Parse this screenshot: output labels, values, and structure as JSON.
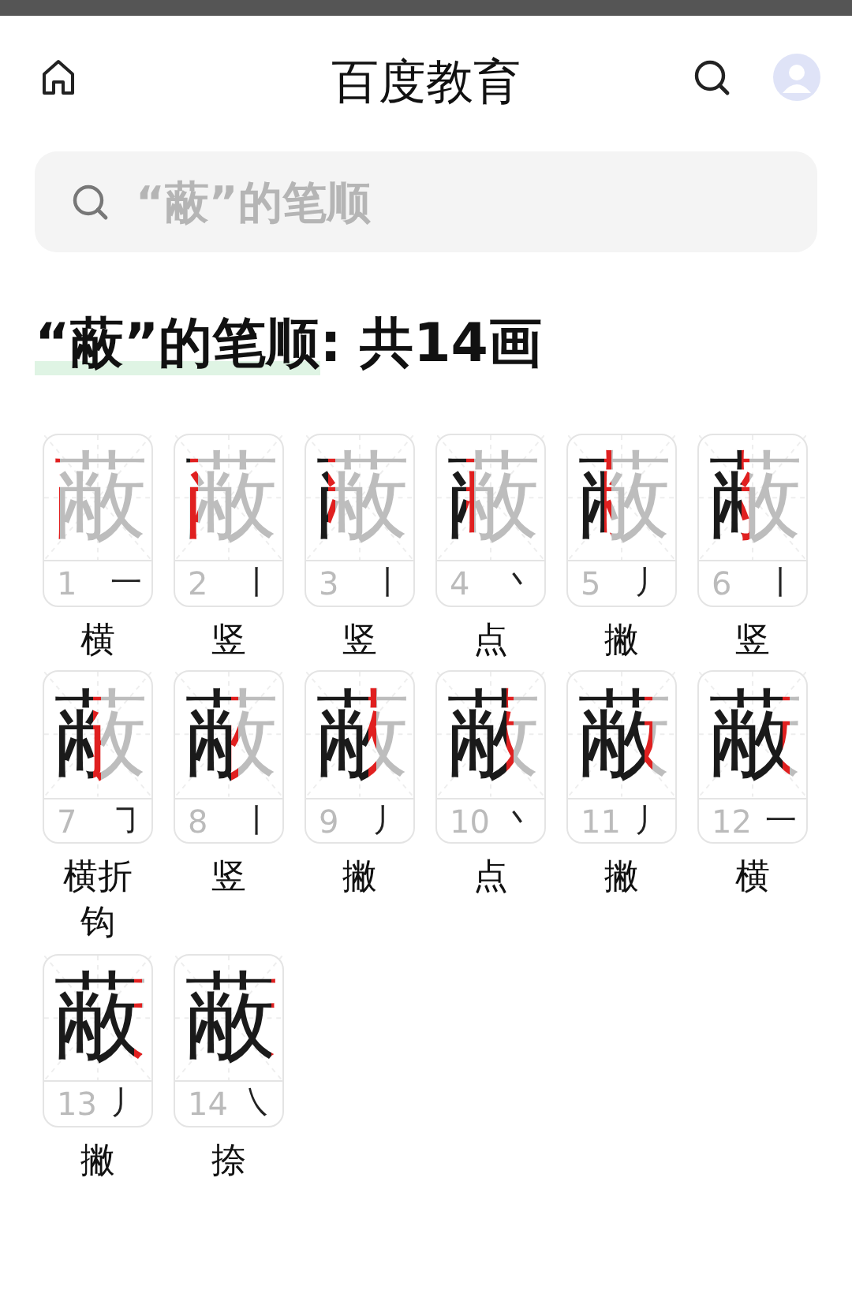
{
  "header": {
    "title": "百度教育"
  },
  "search": {
    "placeholder": "“蔽”的笔顺"
  },
  "heading": {
    "highlight": "“蔽”的笔顺",
    "rest": ": 共14画"
  },
  "strokes": [
    {
      "glyph": "蔽",
      "number": "1",
      "symbol": "一",
      "name": "横"
    },
    {
      "glyph": "蔽",
      "number": "2",
      "symbol": "丨",
      "name": "竖"
    },
    {
      "glyph": "蔽",
      "number": "3",
      "symbol": "丨",
      "name": "竖"
    },
    {
      "glyph": "蔽",
      "number": "4",
      "symbol": "丶",
      "name": "点"
    },
    {
      "glyph": "蔽",
      "number": "5",
      "symbol": "丿",
      "name": "撇"
    },
    {
      "glyph": "蔽",
      "number": "6",
      "symbol": "丨",
      "name": "竖"
    },
    {
      "glyph": "蔽",
      "number": "7",
      "symbol": "㇆",
      "name": "横折钩"
    },
    {
      "glyph": "蔽",
      "number": "8",
      "symbol": "丨",
      "name": "竖"
    },
    {
      "glyph": "蔽",
      "number": "9",
      "symbol": "丿",
      "name": "撇"
    },
    {
      "glyph": "蔽",
      "number": "10",
      "symbol": "丶",
      "name": "点"
    },
    {
      "glyph": "蔽",
      "number": "11",
      "symbol": "丿",
      "name": "撇"
    },
    {
      "glyph": "蔽",
      "number": "12",
      "symbol": "一",
      "name": "横"
    },
    {
      "glyph": "蔽",
      "number": "13",
      "symbol": "丿",
      "name": "撇"
    },
    {
      "glyph": "蔽",
      "number": "14",
      "symbol": "㇏",
      "name": "捺"
    }
  ]
}
